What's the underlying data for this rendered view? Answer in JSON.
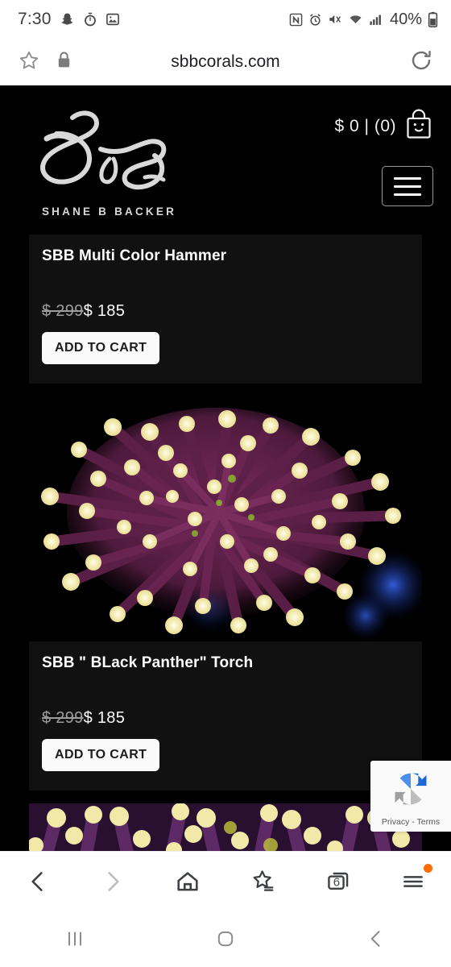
{
  "status_bar": {
    "time": "7:30",
    "left_icons": [
      "snapchat-icon",
      "timer-icon",
      "image-icon"
    ],
    "right_icons": [
      "nfc-icon",
      "alarm-icon",
      "mute-icon",
      "wifi-icon",
      "signal-icon"
    ],
    "battery_percent": "40%"
  },
  "browser": {
    "url": "sbbcorals.com",
    "bookmark_icon": "star-icon",
    "security_icon": "lock-icon",
    "reload_icon": "reload-icon",
    "toolbar": {
      "back": "back-icon",
      "forward": "forward-icon",
      "home": "home-icon",
      "bookmarks": "star-list-icon",
      "tab_count": "6",
      "menu": "menu-icon",
      "menu_has_notification": true
    }
  },
  "site": {
    "logo_alt": "SBB",
    "logo_subtitle": "SHANE B BACKER",
    "cart_label": "$ 0 | (0)",
    "cart_icon": "shopping-bag-icon",
    "menu_button_icon": "hamburger-icon"
  },
  "products": [
    {
      "title": "SBB Multi Color Hammer",
      "old_price": "$ 299",
      "price": "$ 185",
      "add_to_cart": "ADD TO CART",
      "image_alt": "multi-color-hammer-coral-photo"
    },
    {
      "title": "SBB \" BLack Panther\" Torch",
      "old_price": "$ 299",
      "price": "$ 185",
      "add_to_cart": "ADD TO CART",
      "image_alt": "black-panther-torch-coral-photo"
    },
    {
      "title": "",
      "old_price": "",
      "price": "",
      "add_to_cart": "",
      "image_alt": "third-coral-photo-partial"
    }
  ],
  "recaptcha": {
    "privacy_terms": "Privacy - Terms",
    "logo_icon": "recaptcha-icon"
  },
  "android_nav": {
    "recents": "recents-icon",
    "home": "home-circle-icon",
    "back": "back-chevron-icon"
  },
  "colors": {
    "page_background": "#000000",
    "card_background": "#111111",
    "accent_button": "#fafafa",
    "notification_dot": "#ff6d00",
    "coral_body": "#5a2046",
    "coral_tip": "#f5f0b8"
  }
}
